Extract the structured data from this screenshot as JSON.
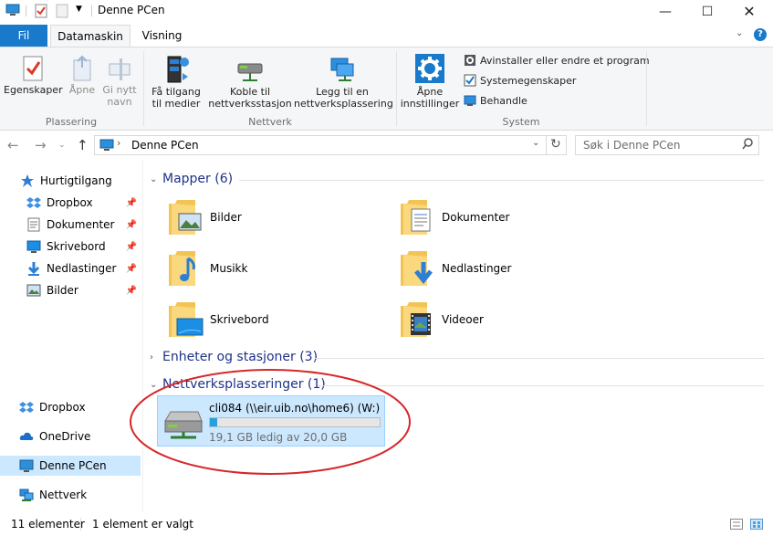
{
  "window": {
    "title": "Denne PCen",
    "controls": [
      "minimize",
      "maximize",
      "close"
    ]
  },
  "tabs": [
    {
      "label": "Fil"
    },
    {
      "label": "Datamaskin"
    },
    {
      "label": "Visning"
    }
  ],
  "ribbon": {
    "groups": [
      {
        "label": "Plassering",
        "buttons": [
          {
            "label": "Egenskaper",
            "icon": "properties-icon",
            "enabled": true
          },
          {
            "label": "Åpne",
            "icon": "open-icon",
            "enabled": false
          },
          {
            "label": "Gi nytt navn",
            "icon": "rename-icon",
            "enabled": false
          }
        ]
      },
      {
        "label": "Nettverk",
        "buttons": [
          {
            "label": "Få tilgang til medier",
            "icon": "media-icon"
          },
          {
            "label": "Koble til nettverksstasjon",
            "icon": "map-drive-icon"
          },
          {
            "label": "Legg til en nettverksplassering",
            "icon": "network-location-icon"
          }
        ]
      },
      {
        "label": "System",
        "buttons": [
          {
            "label": "Åpne innstillinger",
            "icon": "settings-gear-icon"
          }
        ],
        "small_buttons": [
          {
            "label": "Avinstaller eller endre et program",
            "icon": "uninstall-icon"
          },
          {
            "label": "Systemegenskaper",
            "icon": "system-properties-icon"
          },
          {
            "label": "Behandle",
            "icon": "manage-icon"
          }
        ]
      }
    ]
  },
  "address": {
    "path": "Denne PCen",
    "search_placeholder": "Søk i Denne PCen"
  },
  "nav": {
    "quick_access": "Hurtigtilgang",
    "pinned": [
      {
        "label": "Dropbox",
        "icon": "dropbox-icon"
      },
      {
        "label": "Dokumenter",
        "icon": "documents-icon"
      },
      {
        "label": "Skrivebord",
        "icon": "desktop-icon"
      },
      {
        "label": "Nedlastinger",
        "icon": "downloads-icon"
      },
      {
        "label": "Bilder",
        "icon": "pictures-icon"
      }
    ],
    "roots": [
      {
        "label": "Dropbox",
        "icon": "dropbox-icon"
      },
      {
        "label": "OneDrive",
        "icon": "onedrive-icon"
      },
      {
        "label": "Denne PCen",
        "icon": "computer-icon",
        "selected": true
      },
      {
        "label": "Nettverk",
        "icon": "network-icon"
      }
    ]
  },
  "groups": {
    "folders_header": "Mapper (6)",
    "devices_header": "Enheter og stasjoner (3)",
    "network_header": "Nettverksplasseringer (1)"
  },
  "folders": [
    {
      "label": "Bilder",
      "overlay": "pictures"
    },
    {
      "label": "Dokumenter",
      "overlay": "documents"
    },
    {
      "label": "Musikk",
      "overlay": "music"
    },
    {
      "label": "Nedlastinger",
      "overlay": "downloads"
    },
    {
      "label": "Skrivebord",
      "overlay": "desktop"
    },
    {
      "label": "Videoer",
      "overlay": "videos"
    }
  ],
  "network_drive": {
    "name": "cli084 (\\\\eir.uib.no\\home6) (W:)",
    "free_text": "19,1 GB ledig av 20,0 GB",
    "used_fraction": 0.045
  },
  "status": {
    "count": "11 elementer",
    "selection": "1 element er valgt"
  },
  "colors": {
    "accent": "#1979ca",
    "selection": "#cce8ff",
    "header_text": "#1e3287",
    "annotation": "#d6282a"
  }
}
